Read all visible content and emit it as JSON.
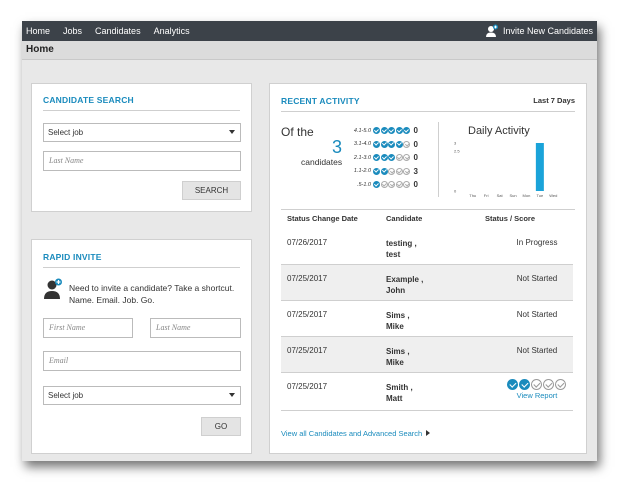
{
  "nav": {
    "items": [
      "Home",
      "Jobs",
      "Candidates",
      "Analytics"
    ],
    "invite_label": "Invite New Candidates"
  },
  "page": {
    "title": "Home"
  },
  "candidate_search": {
    "title": "CANDIDATE SEARCH",
    "job_select": "Select job",
    "last_name_placeholder": "Last Name",
    "search_button": "SEARCH"
  },
  "rapid_invite": {
    "title": "RAPID INVITE",
    "message_line1": "Need to invite a candidate? Take a shortcut.",
    "message_line2": "Name. Email. Job. Go.",
    "first_name_placeholder": "First Name",
    "last_name_placeholder": "Last Name",
    "email_placeholder": "Email",
    "job_select": "Select job",
    "go_button": "GO"
  },
  "recent_activity": {
    "title": "RECENT ACTIVITY",
    "range": "Last 7 Days",
    "of_the": "Of the",
    "total": "3",
    "candidates_label": "candidates",
    "score_rows": [
      {
        "range": "4.1-5.0",
        "filled": 5,
        "count": "0"
      },
      {
        "range": "3.1-4.0",
        "filled": 4,
        "count": "0"
      },
      {
        "range": "2.1-3.0",
        "filled": 3,
        "count": "0"
      },
      {
        "range": "1.1-2.0",
        "filled": 2,
        "count": "3"
      },
      {
        "range": ".5-1.0",
        "filled": 1,
        "count": "0"
      }
    ],
    "daily_activity_title": "Daily Activity",
    "columns": {
      "date": "Status Change Date",
      "candidate": "Candidate",
      "status": "Status / Score"
    },
    "rows": [
      {
        "date": "07/26/2017",
        "name_line1": "testing ,",
        "name_line2": "test",
        "status": "In Progress"
      },
      {
        "date": "07/25/2017",
        "name_line1": "Example ,",
        "name_line2": "John",
        "status": "Not Started"
      },
      {
        "date": "07/25/2017",
        "name_line1": "Sims ,",
        "name_line2": "Mike",
        "status": "Not Started"
      },
      {
        "date": "07/25/2017",
        "name_line1": "Sims ,",
        "name_line2": "Mike",
        "status": "Not Started"
      },
      {
        "date": "07/25/2017",
        "name_line1": "Smith ,",
        "name_line2": "Matt",
        "score": 2,
        "score_max": 5,
        "status_link": "View Report"
      }
    ],
    "view_all_link": "View all Candidates and Advanced Search",
    "accent_color": "#1a8bbd"
  },
  "chart_data": {
    "type": "bar",
    "title": "Daily Activity",
    "categories": [
      "Thu",
      "Fri",
      "Sat",
      "Sun",
      "Mon",
      "Tue",
      "Wed"
    ],
    "values": [
      0,
      0,
      0,
      0,
      0,
      3,
      0
    ],
    "yticks": [
      "3",
      "2.5",
      "0"
    ],
    "ylim": [
      0,
      3
    ],
    "color": "#1aa3d9"
  }
}
